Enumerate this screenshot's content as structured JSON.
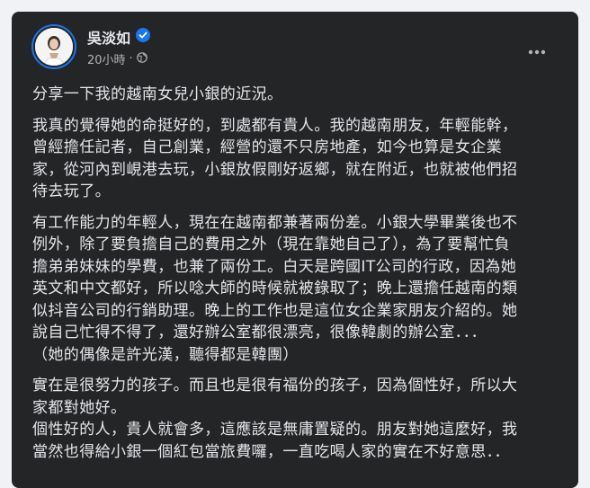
{
  "author": {
    "name": "吳淡如",
    "verified": true
  },
  "meta": {
    "time": "20小時",
    "separator": "·",
    "audience_icon": "globe-icon"
  },
  "menu_icon": "more-options-icon",
  "post": {
    "paragraphs": [
      "分享一下我的越南女兒小銀的近況。",
      "我真的覺得她的命挺好的，到處都有貴人。我的越南朋友，年輕能幹，\n曾經擔任記者，自己創業，經營的還不只房地產，如今也算是女企業\n家，從河內到峴港去玩，小銀放假剛好返鄉，就在附近，也就被他們招\n待去玩了。",
      "有工作能力的年輕人，現在在越南都兼著兩份差。小銀大學畢業後也不\n例外，除了要負擔自己的費用之外（現在靠她自己了），為了要幫忙負\n擔弟弟妹妹的學費，也兼了兩份工。白天是跨國IT公司的行政，因為她\n英文和中文都好，所以唸大師的時候就被錄取了；晚上還擔任越南的類\n似抖音公司的行銷助理。晚上的工作也是這位女企業家朋友介紹的。她\n說自己忙得不得了，還好辦公室都很漂亮，很像韓劇的辦公室．．．\n（她的偶像是許光漢，聽得都是韓團）",
      "實在是很努力的孩子。而且也是很有福份的孩子，因為個性好，所以大\n家都對她好。\n個性好的人，貴人就會多，這應該是無庸置疑的。朋友對她這麼好，我\n當然也得給小銀一個紅包當旅費囉，一直吃喝人家的實在不好意思．．"
    ]
  },
  "colors": {
    "card_background": "#242526",
    "text_primary": "#e4e6eb",
    "text_secondary": "#b0b3b8",
    "verified_badge": "#1877f2"
  }
}
